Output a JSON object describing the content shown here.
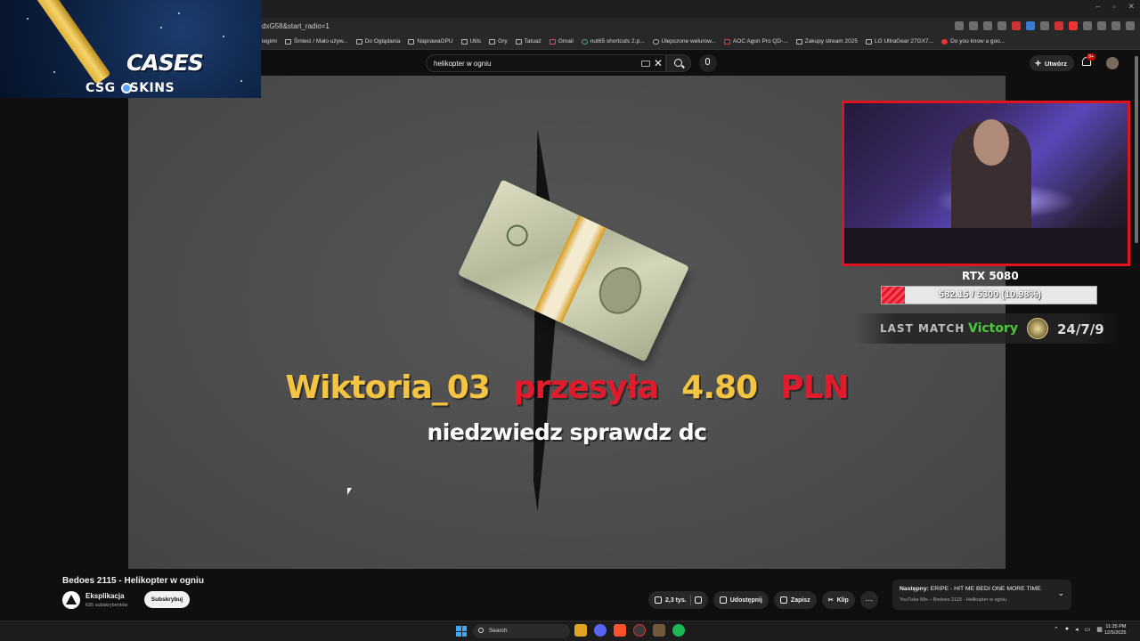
{
  "browser": {
    "url": "dxG58&start_radio=1",
    "bookmarks": [
      "legimi",
      "Śmieci / Mało używ...",
      "Do Oglądania",
      "NaprawaGPU",
      "Utils",
      "Gry",
      "Tatuaż",
      "Gmail",
      "nut65 shortcuts 2.p...",
      "Ulepszone welurow...",
      "AOC Agon Pro QD-...",
      "Zakupy stream 2025",
      "LG UltraGear 27GX7...",
      "Do you know a goo..."
    ]
  },
  "youtube": {
    "search_value": "helikopter w ogniu",
    "create_label": "Utwórz",
    "notifications_badge": "9+"
  },
  "overlay": {
    "promo_word": "CASES",
    "promo_brand_left": "CSG",
    "promo_brand_right": "SKINS",
    "alert_user": "Wiktoria_03",
    "alert_verb": "przesyła",
    "alert_amount": "4.80",
    "alert_currency": "PLN",
    "alert_message": "niedzwiedz sprawdz dc",
    "goal_title": "RTX 5080",
    "goal_text": "582.15 / 5300 (10.98%)",
    "goal_fraction": 0.1098,
    "match_label": "LAST MATCH",
    "match_result": "Victory",
    "match_score": "24/7/9"
  },
  "video": {
    "title": "Bedoes 2115 - Helikopter w ogniu",
    "channel": "Eksplikacja",
    "subscribers": "635 subskrybentów",
    "subscribe_label": "Subskrybuj",
    "likes": "2,3 tys.",
    "share_label": "Udostępnij",
    "save_label": "Zapisz",
    "clip_label": "Klip"
  },
  "up_next": {
    "prefix": "Następny:",
    "title": "ERIPE - HIT ME BEDI ONE MORE TIME",
    "subtitle": "YouTube Mix – Bedoes 2115 - Helikopter w ogniu"
  },
  "taskbar": {
    "search_placeholder": "Search",
    "time": "11:25 PM",
    "date": "12/5/2025"
  }
}
